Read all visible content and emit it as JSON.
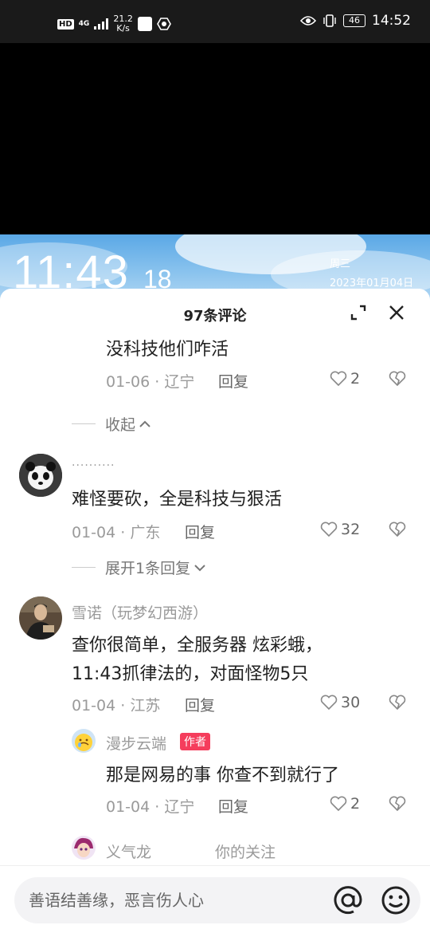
{
  "status_bar": {
    "hd": "HD",
    "network": "4G",
    "speed_value": "21.2",
    "speed_unit": "K/s",
    "battery": "46",
    "time": "14:52"
  },
  "video": {
    "clock_time": "11:43",
    "clock_seconds": "18",
    "weekday": "周三",
    "date": "2023年01月04日"
  },
  "sheet": {
    "title": "97条评论"
  },
  "comments": {
    "c1": {
      "text": "没科技他们咋活",
      "meta": "01-06 · 辽宁",
      "reply": "回复",
      "likes": "2"
    },
    "collapse_label": "收起",
    "c2": {
      "name": "..........",
      "text": "难怪要砍，全是科技与狠活",
      "meta": "01-04 · 广东",
      "reply": "回复",
      "likes": "32",
      "expand_label": "展开1条回复"
    },
    "c3": {
      "name": "雪诺（玩梦幻西游）",
      "text_line1": "查你很简单，全服务器 炫彩蛾，",
      "text_line2": "11:43抓律法的，对面怪物5只",
      "meta": "01-04 · 江苏",
      "reply": "回复",
      "likes": "30"
    },
    "c4": {
      "name": "漫步云端",
      "badge": "作者",
      "text": "那是网易的事 你查不到就行了",
      "meta": "01-04 · 辽宁",
      "reply": "回复",
      "likes": "2"
    },
    "c5": {
      "name": "义气龙",
      "tag": "你的关注"
    }
  },
  "input": {
    "placeholder": "善语结善缘，恶言伤人心"
  },
  "colors": {
    "author_badge": "#f53d5c",
    "meta_gray": "#9a9a9a"
  }
}
